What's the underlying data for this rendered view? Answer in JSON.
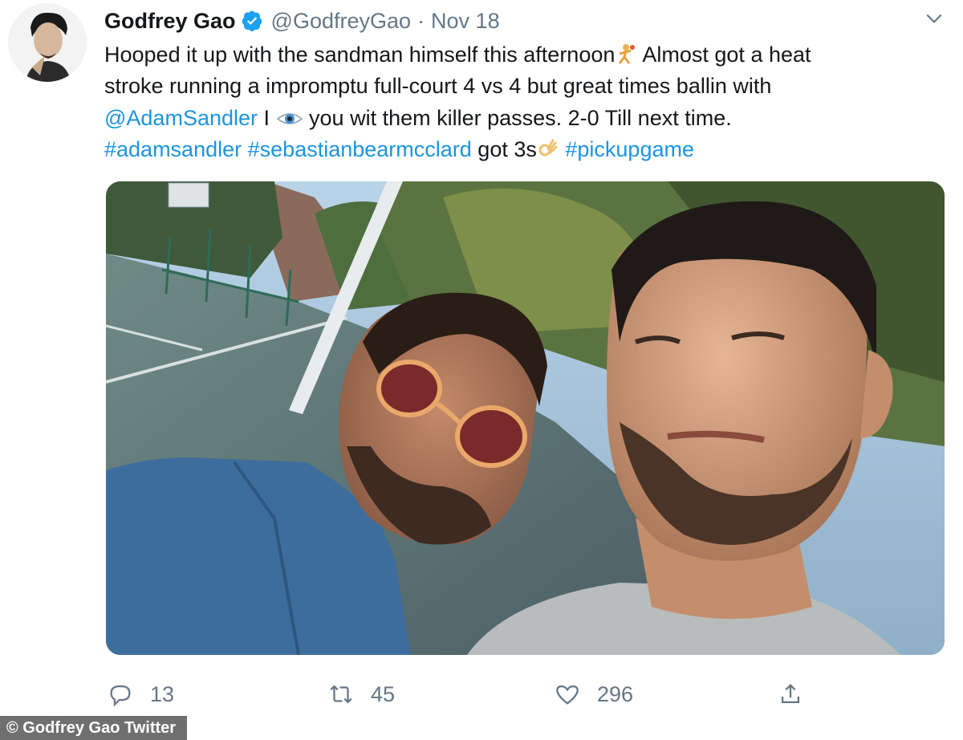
{
  "tweet": {
    "author_name": "Godfrey Gao",
    "verified": true,
    "handle": "@GodfreyGao",
    "separator": "·",
    "date": "Nov 18",
    "text": {
      "line1_a": "Hooped it up with the sandman himself this afternoon",
      "line1_b": " Almost got a heat",
      "line2": "stroke running a impromptu full-court 4 vs 4 but great times ballin with",
      "line3_mention": "@AdamSandler",
      "line3_a": " I ",
      "line3_b": "  you wit them killer passes. 2-0 Till next time.",
      "line4_tag1": "#adamsandler",
      "line4_tag2": "#sebastianbearmcclard",
      "line4_mid": " got 3s",
      "line4_tag3": "#pickupgame"
    },
    "photo_alt": "Selfie of two men on a basketball court"
  },
  "actions": {
    "replies": "13",
    "retweets": "45",
    "likes": "296"
  },
  "credit": "© Godfrey Gao Twitter",
  "icons": [
    "verified-badge-icon",
    "caret-down-icon",
    "reply-icon",
    "retweet-icon",
    "like-icon",
    "share-icon"
  ],
  "colors": {
    "link": "#1b95e0",
    "secondary": "#657786",
    "verified": "#1da1f2"
  }
}
